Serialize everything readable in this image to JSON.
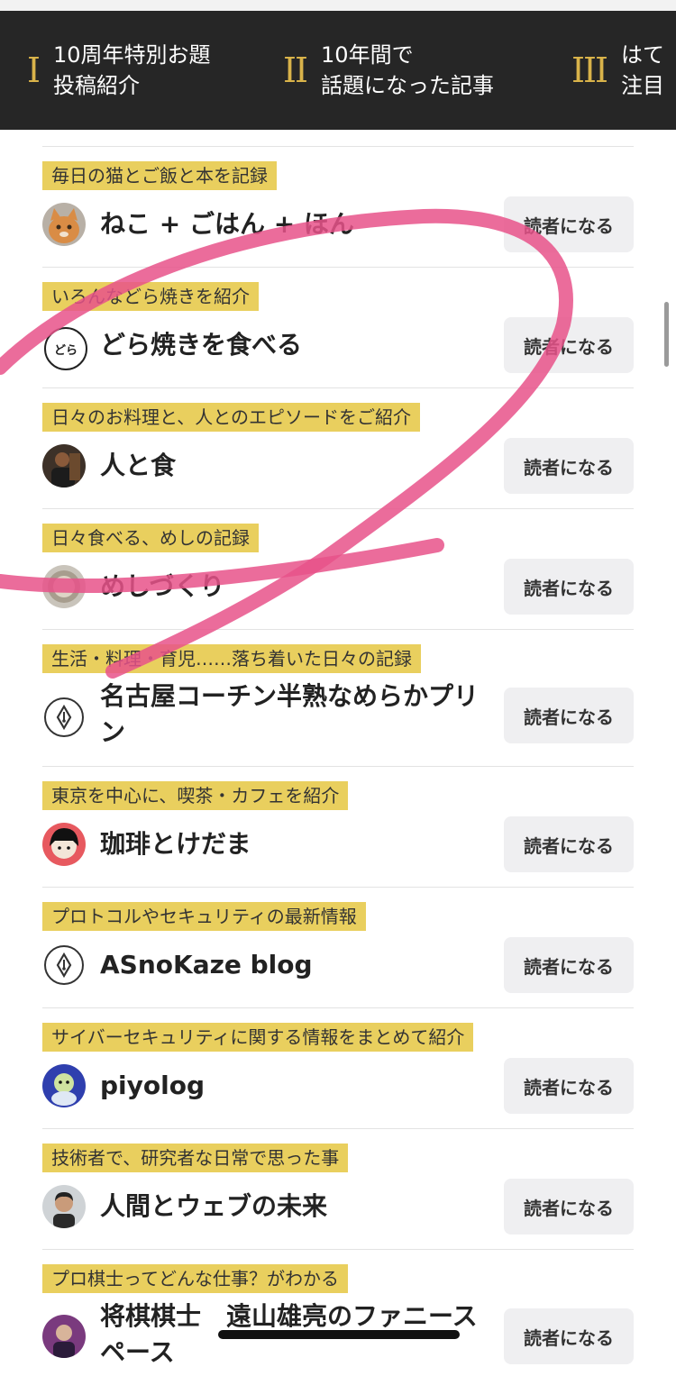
{
  "nav": {
    "items": [
      {
        "num": "I",
        "text": "10周年特別お題\n投稿紹介"
      },
      {
        "num": "II",
        "text": "10年間で\n話題になった記事"
      },
      {
        "num": "III",
        "text": "はて\n注目"
      }
    ]
  },
  "blogs": [
    {
      "tagline": "毎日の猫とご飯と本を記録",
      "name": "ねこ + ごはん + ほん",
      "button": "読者になる",
      "avatar": "cat-photo"
    },
    {
      "tagline": "いろんなどら焼きを紹介",
      "name": "どら焼きを食べる",
      "button": "読者になる",
      "avatar": "dora-logo",
      "avatar_text": "どら"
    },
    {
      "tagline": "日々のお料理と、人とのエピソードをご紹介",
      "name": "人と食",
      "button": "読者になる",
      "avatar": "person-photo"
    },
    {
      "tagline": "日々食べる、めしの記録",
      "name": "めしづくり",
      "button": "読者になる",
      "avatar": "bowl-photo"
    },
    {
      "tagline": "生活・料理・育児……落ち着いた日々の記録",
      "name": "名古屋コーチン半熟なめらかプリン",
      "button": "読者になる",
      "avatar": "pen-nib-icon"
    },
    {
      "tagline": "東京を中心に、喫茶・カフェを紹介",
      "name": "珈琲とけだま",
      "button": "読者になる",
      "avatar": "illustration-avatar"
    },
    {
      "tagline": "プロトコルやセキュリティの最新情報",
      "name": "ASnoKaze blog",
      "button": "読者になる",
      "avatar": "pen-nib-icon"
    },
    {
      "tagline": "サイバーセキュリティに関する情報をまとめて紹介",
      "name": "piyolog",
      "button": "読者になる",
      "avatar": "piyo-character"
    },
    {
      "tagline": "技術者で、研究者な日常で思った事",
      "name": "人間とウェブの未来",
      "button": "読者になる",
      "avatar": "person-photo"
    },
    {
      "tagline": "プロ棋士ってどんな仕事？がわかる",
      "name": "将棋棋士　遠山雄亮のファニースペース",
      "button": "読者になる",
      "avatar": "shogi-photo"
    }
  ],
  "colors": {
    "tagline_bg": "#e9cf5e",
    "nav_bg": "#262626",
    "nav_num": "#d9b34a",
    "annotation_stroke": "#e8528a"
  }
}
